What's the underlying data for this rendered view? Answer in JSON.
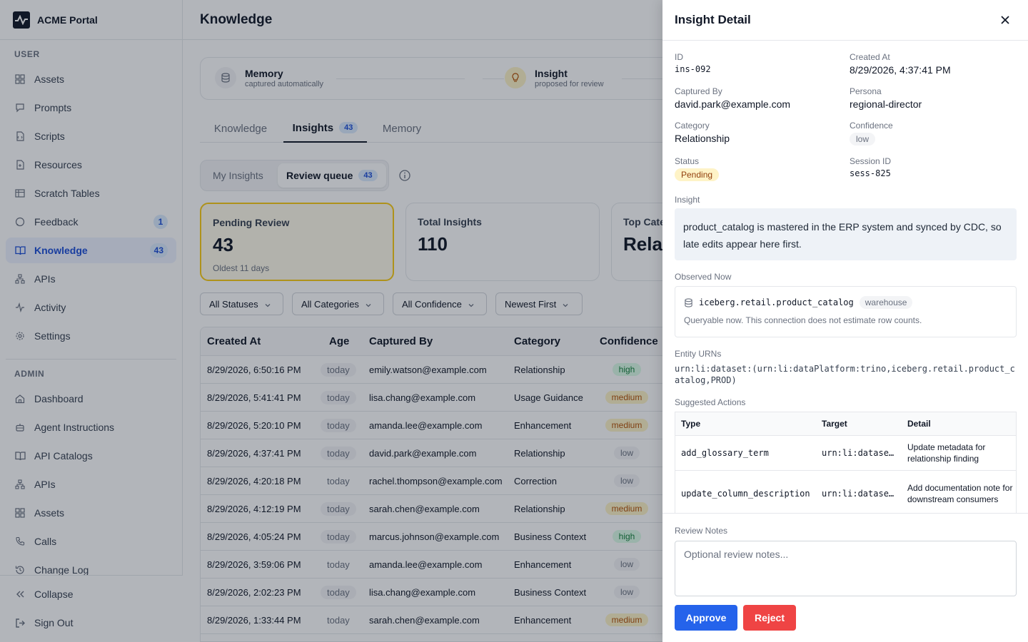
{
  "app": {
    "name": "ACME Portal"
  },
  "sidebar": {
    "user_label": "USER",
    "user_items": [
      {
        "label": "Assets",
        "icon": "grid-icon"
      },
      {
        "label": "Prompts",
        "icon": "chat-icon"
      },
      {
        "label": "Scripts",
        "icon": "script-icon"
      },
      {
        "label": "Resources",
        "icon": "file-icon"
      },
      {
        "label": "Scratch Tables",
        "icon": "table-icon"
      },
      {
        "label": "Feedback",
        "icon": "feedback-icon",
        "badge": "1"
      },
      {
        "label": "Knowledge",
        "icon": "book-icon",
        "badge": "43",
        "active": true
      },
      {
        "label": "APIs",
        "icon": "api-icon"
      },
      {
        "label": "Activity",
        "icon": "activity-icon"
      },
      {
        "label": "Settings",
        "icon": "gear-icon"
      }
    ],
    "admin_label": "ADMIN",
    "admin_items": [
      {
        "label": "Dashboard",
        "icon": "home-icon"
      },
      {
        "label": "Agent Instructions",
        "icon": "bot-icon"
      },
      {
        "label": "API Catalogs",
        "icon": "book-icon"
      },
      {
        "label": "APIs",
        "icon": "api-icon"
      },
      {
        "label": "Assets",
        "icon": "grid-icon"
      },
      {
        "label": "Calls",
        "icon": "phone-icon"
      },
      {
        "label": "Change Log",
        "icon": "history-icon"
      }
    ],
    "collapse_label": "Collapse",
    "signout_label": "Sign Out"
  },
  "main": {
    "title": "Knowledge",
    "flow": [
      {
        "title": "Memory",
        "sub": "captured automatically"
      },
      {
        "title": "Insight",
        "sub": "proposed for review"
      }
    ],
    "tabs": [
      {
        "label": "Knowledge"
      },
      {
        "label": "Insights",
        "count": "43"
      },
      {
        "label": "Memory"
      }
    ],
    "seg": {
      "my": "My Insights",
      "queue": "Review queue",
      "queue_count": "43"
    },
    "cards": [
      {
        "title": "Pending Review",
        "value": "43",
        "sub": "Oldest 11 days"
      },
      {
        "title": "Total Insights",
        "value": "110"
      },
      {
        "title": "Top Cate",
        "value": "Relat"
      }
    ],
    "filters": [
      "All Statuses",
      "All Categories",
      "All Confidence",
      "Newest First"
    ],
    "table": {
      "headers": [
        "Created At",
        "Age",
        "Captured By",
        "Category",
        "Confidence"
      ],
      "rows": [
        {
          "created": "8/29/2026, 6:50:16 PM",
          "age": "today",
          "by": "emily.watson@example.com",
          "category": "Relationship",
          "confidence": "high",
          "pill": true
        },
        {
          "created": "8/29/2026, 5:41:41 PM",
          "age": "today",
          "by": "lisa.chang@example.com",
          "category": "Usage Guidance",
          "confidence": "medium",
          "pill": true
        },
        {
          "created": "8/29/2026, 5:20:10 PM",
          "age": "today",
          "by": "amanda.lee@example.com",
          "category": "Enhancement",
          "confidence": "medium",
          "pill": true
        },
        {
          "created": "8/29/2026, 4:37:41 PM",
          "age": "today",
          "by": "david.park@example.com",
          "category": "Relationship",
          "confidence": "low",
          "pill": true
        },
        {
          "created": "8/29/2026, 4:20:18 PM",
          "age": "today",
          "by": "rachel.thompson@example.com",
          "category": "Correction",
          "confidence": "low",
          "pill": false
        },
        {
          "created": "8/29/2026, 4:12:19 PM",
          "age": "today",
          "by": "sarah.chen@example.com",
          "category": "Relationship",
          "confidence": "medium",
          "pill": true
        },
        {
          "created": "8/29/2026, 4:05:24 PM",
          "age": "today",
          "by": "marcus.johnson@example.com",
          "category": "Business Context",
          "confidence": "high",
          "pill": true
        },
        {
          "created": "8/29/2026, 3:59:06 PM",
          "age": "today",
          "by": "amanda.lee@example.com",
          "category": "Enhancement",
          "confidence": "low",
          "pill": false
        },
        {
          "created": "8/29/2026, 2:02:23 PM",
          "age": "today",
          "by": "lisa.chang@example.com",
          "category": "Business Context",
          "confidence": "low",
          "pill": true
        },
        {
          "created": "8/29/2026, 1:33:44 PM",
          "age": "today",
          "by": "sarah.chen@example.com",
          "category": "Enhancement",
          "confidence": "medium",
          "pill": false
        }
      ]
    }
  },
  "panel": {
    "title": "Insight Detail",
    "id_label": "ID",
    "id": "ins-092",
    "created_label": "Created At",
    "created": "8/29/2026, 4:37:41 PM",
    "captured_label": "Captured By",
    "captured": "david.park@example.com",
    "persona_label": "Persona",
    "persona": "regional-director",
    "category_label": "Category",
    "category": "Relationship",
    "confidence_label": "Confidence",
    "confidence": "low",
    "status_label": "Status",
    "status": "Pending",
    "session_label": "Session ID",
    "session": "sess-825",
    "insight_label": "Insight",
    "insight": "product_catalog is mastered in the ERP system and synced by CDC, so late edits appear here first.",
    "observed_label": "Observed Now",
    "observed_name": "iceberg.retail.product_catalog",
    "observed_tag": "warehouse",
    "observed_note": "Queryable now. This connection does not estimate row counts.",
    "urns_label": "Entity URNs",
    "urn": "urn:li:dataset:(urn:li:dataPlatform:trino,iceberg.retail.product_catalog,PROD)",
    "actions_label": "Suggested Actions",
    "actions_headers": [
      "Type",
      "Target",
      "Detail"
    ],
    "actions": [
      {
        "type": "add_glossary_term",
        "target": "urn:li:datase…",
        "detail": "Update metadata for relationship finding"
      },
      {
        "type": "update_column_description",
        "target": "urn:li:datase…",
        "detail": "Add documentation note for downstream consumers"
      }
    ],
    "notes_label": "Review Notes",
    "notes_placeholder": "Optional review notes...",
    "approve_label": "Approve",
    "reject_label": "Reject"
  }
}
